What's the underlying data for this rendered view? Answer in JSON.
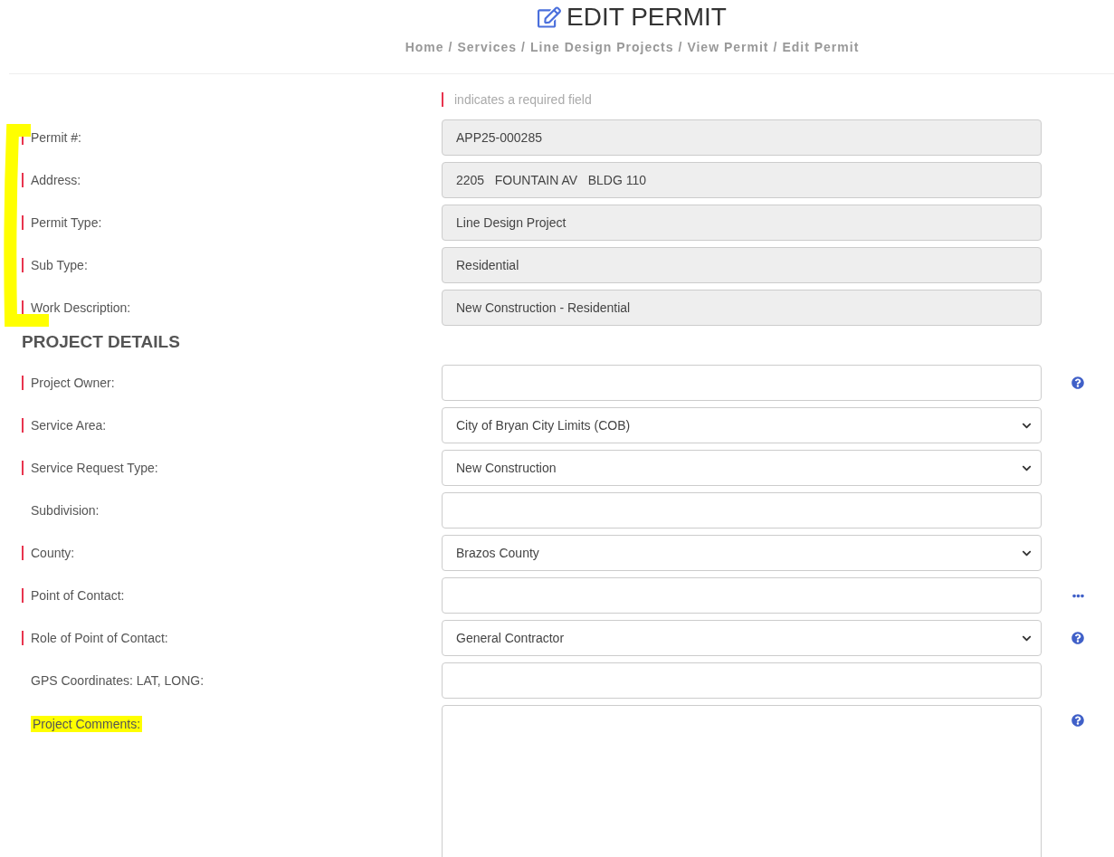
{
  "title": "EDIT PERMIT",
  "breadcrumb": [
    "Home",
    "Services",
    "Line Design Projects",
    "View Permit",
    "Edit Permit"
  ],
  "breadcrumb_separator": "/",
  "required_note": "indicates a required field",
  "permit_info": {
    "bracketed": true,
    "fields": [
      {
        "label": "Permit #:",
        "value": "APP25-000285",
        "required": true
      },
      {
        "label": "Address:",
        "value": "2205   FOUNTAIN AV   BLDG 110",
        "required": true
      },
      {
        "label": "Permit Type:",
        "value": "Line Design Project",
        "required": true
      },
      {
        "label": "Sub Type:",
        "value": "Residential",
        "required": true
      },
      {
        "label": "Work Description:",
        "value": "New Construction - Residential",
        "required": true
      }
    ]
  },
  "section_title": "PROJECT DETAILS",
  "project_fields": [
    {
      "label": "Project Owner:",
      "kind": "text",
      "required": true,
      "highlighted": false,
      "side_icon": {
        "kind": "help"
      }
    },
    {
      "label": "Service Area:",
      "kind": "select",
      "value": "City of Bryan City Limits (COB)",
      "required": true,
      "highlighted": false
    },
    {
      "label": "Service Request Type:",
      "kind": "select",
      "value": "New Construction",
      "required": true,
      "highlighted": false
    },
    {
      "label": "Subdivision:",
      "kind": "text",
      "required": false,
      "highlighted": false
    },
    {
      "label": "County:",
      "kind": "select",
      "value": "Brazos County",
      "required": true,
      "highlighted": false
    },
    {
      "label": "Point of Contact:",
      "kind": "text",
      "required": true,
      "highlighted": false,
      "side_icon": {
        "kind": "more"
      }
    },
    {
      "label": "Role of Point of Contact:",
      "kind": "select",
      "value": "General Contractor",
      "required": true,
      "highlighted": false,
      "side_icon": {
        "kind": "help"
      }
    },
    {
      "label": "GPS Coordinates: LAT, LONG:",
      "kind": "text",
      "required": false,
      "highlighted": false
    },
    {
      "label": "Project Comments:",
      "kind": "textarea",
      "required": false,
      "highlighted": true,
      "side_icon": {
        "kind": "help"
      }
    }
  ]
}
